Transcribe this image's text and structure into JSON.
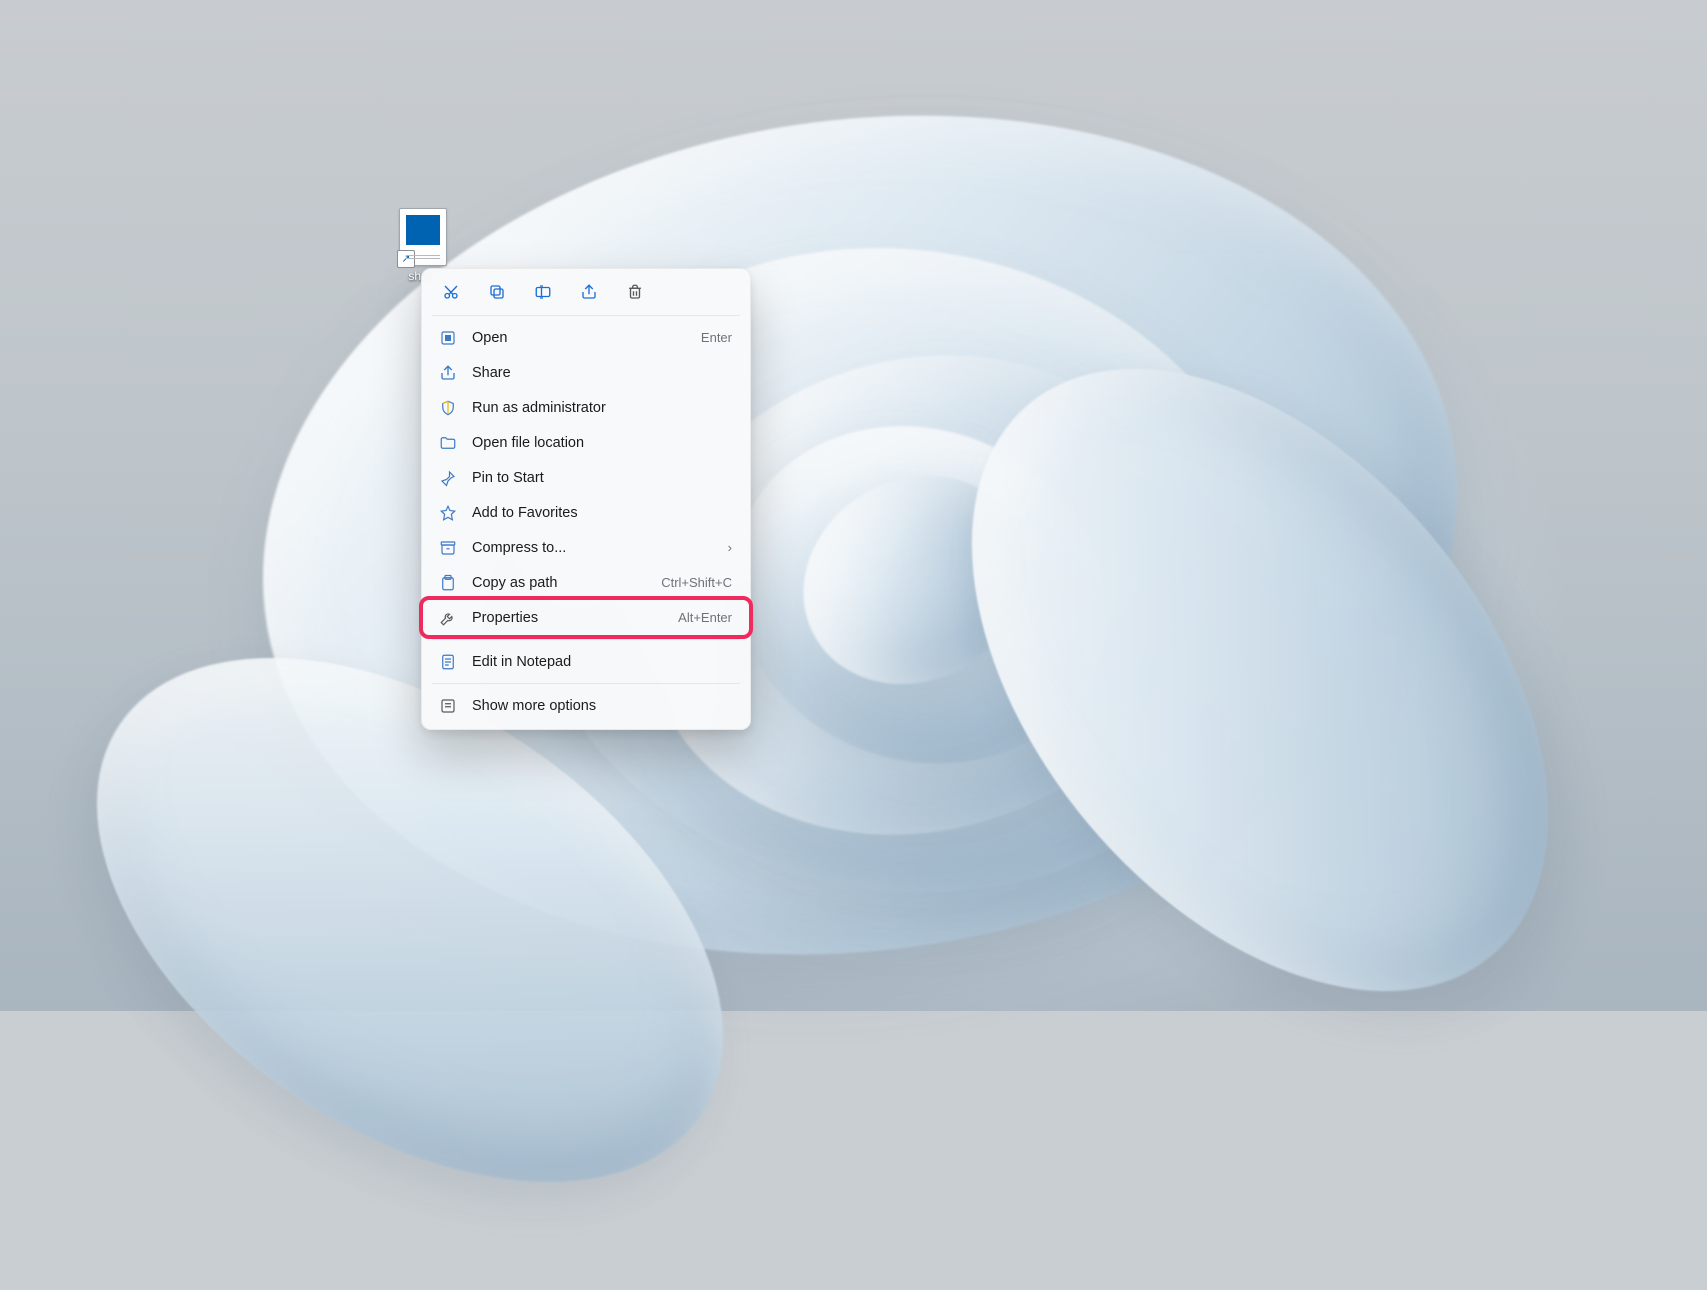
{
  "desktop": {
    "shortcut": {
      "label": "shutd"
    }
  },
  "context_menu": {
    "toolbar_icons": [
      "cut",
      "copy",
      "rename",
      "share",
      "delete"
    ],
    "groups": [
      [
        {
          "id": "open",
          "label": "Open",
          "shortcut": "Enter",
          "icon": "open"
        },
        {
          "id": "share",
          "label": "Share",
          "shortcut": "",
          "icon": "share"
        },
        {
          "id": "run-admin",
          "label": "Run as administrator",
          "shortcut": "",
          "icon": "shield"
        },
        {
          "id": "open-location",
          "label": "Open file location",
          "shortcut": "",
          "icon": "folder"
        },
        {
          "id": "pin-start",
          "label": "Pin to Start",
          "shortcut": "",
          "icon": "pin"
        },
        {
          "id": "add-fav",
          "label": "Add to Favorites",
          "shortcut": "",
          "icon": "star"
        },
        {
          "id": "compress",
          "label": "Compress to...",
          "shortcut": "",
          "icon": "archive",
          "submenu": true
        },
        {
          "id": "copy-path",
          "label": "Copy as path",
          "shortcut": "Ctrl+Shift+C",
          "icon": "copypath"
        },
        {
          "id": "properties",
          "label": "Properties",
          "shortcut": "Alt+Enter",
          "icon": "wrench",
          "highlight": true
        }
      ],
      [
        {
          "id": "edit-notepad",
          "label": "Edit in Notepad",
          "shortcut": "",
          "icon": "notepad"
        }
      ],
      [
        {
          "id": "more-options",
          "label": "Show more options",
          "shortcut": "",
          "icon": "more"
        }
      ]
    ]
  }
}
